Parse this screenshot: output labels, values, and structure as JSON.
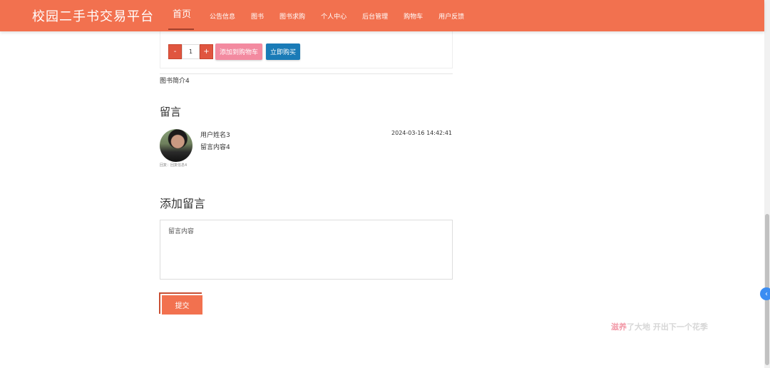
{
  "header": {
    "brand": "校园二手书交易平台",
    "nav": [
      {
        "label": "首页",
        "active": true
      },
      {
        "label": "公告信息"
      },
      {
        "label": "图书"
      },
      {
        "label": "图书求购"
      },
      {
        "label": "个人中心"
      },
      {
        "label": "后台管理"
      },
      {
        "label": "购物车"
      },
      {
        "label": "用户反馈"
      }
    ]
  },
  "purchase": {
    "minus_label": "-",
    "quantity": "1",
    "plus_label": "+",
    "add_cart_label": "添加到购物车",
    "buy_now_label": "立即购买"
  },
  "book": {
    "intro": "图书简介4"
  },
  "comments": {
    "title": "留言",
    "items": [
      {
        "user": "用户姓名3",
        "time": "2024-03-16 14:42:41",
        "content": "留言内容4",
        "reply": "回复：回复信息4"
      }
    ]
  },
  "add_comment": {
    "title": "添加留言",
    "placeholder": "留言内容",
    "submit_label": "提交"
  },
  "footer": {
    "slogan_highlight": "滋养",
    "slogan_rest": "了大地 开出下一个花季"
  },
  "side_toggle_icon": "‹",
  "colors": {
    "primary": "#f2714f",
    "add_cart": "#f38aa0",
    "buy_now": "#1a7bb7",
    "side_toggle": "#3b8df2"
  }
}
